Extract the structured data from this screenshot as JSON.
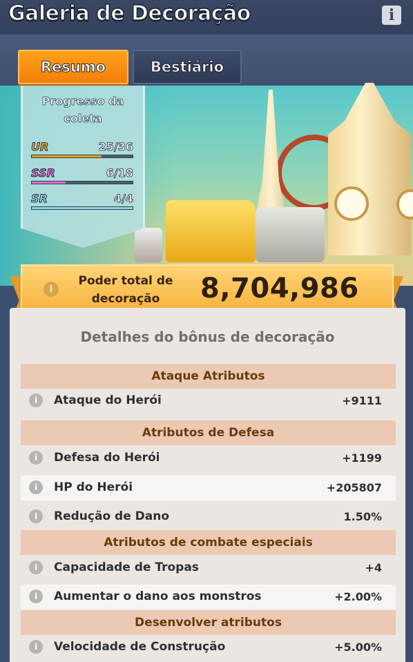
{
  "header": {
    "title": "Galeria de Decoração",
    "info_icon": "info-icon"
  },
  "tabs": [
    {
      "label": "Resumo",
      "active": true
    },
    {
      "label": "Bestiário",
      "active": false
    }
  ],
  "collection": {
    "title": "Progresso da coleta",
    "rarities": [
      {
        "name": "UR",
        "count": "25/36",
        "progress": 0.694,
        "color": "#f0a21a"
      },
      {
        "name": "SSR",
        "count": "6/18",
        "progress": 0.333,
        "color": "#e46bd8"
      },
      {
        "name": "SR",
        "count": "4/4",
        "progress": 1.0,
        "color": "#8fd7ee"
      }
    ]
  },
  "power": {
    "label": "Poder total de decoração",
    "value": "8,704,986"
  },
  "details": {
    "title": "Detalhes do bônus de decoração",
    "sections": [
      {
        "title": "Ataque Atributos",
        "rows": [
          {
            "label": "Ataque do Herói",
            "value": "+9111"
          }
        ]
      },
      {
        "title": "Atributos de Defesa",
        "rows": [
          {
            "label": "Defesa do Herói",
            "value": "+1199"
          },
          {
            "label": "HP do Herói",
            "value": "+205807"
          },
          {
            "label": "Redução de Dano",
            "value": "1.50%"
          }
        ]
      },
      {
        "title": "Atributos de combate especiais",
        "rows": [
          {
            "label": "Capacidade de Tropas",
            "value": "+4"
          },
          {
            "label": "Aumentar o dano aos monstros",
            "value": "+2.00%"
          }
        ]
      },
      {
        "title": "Desenvolver atributos",
        "rows": [
          {
            "label": "Velocidade de Construção",
            "value": "+5.00%"
          }
        ]
      }
    ]
  }
}
